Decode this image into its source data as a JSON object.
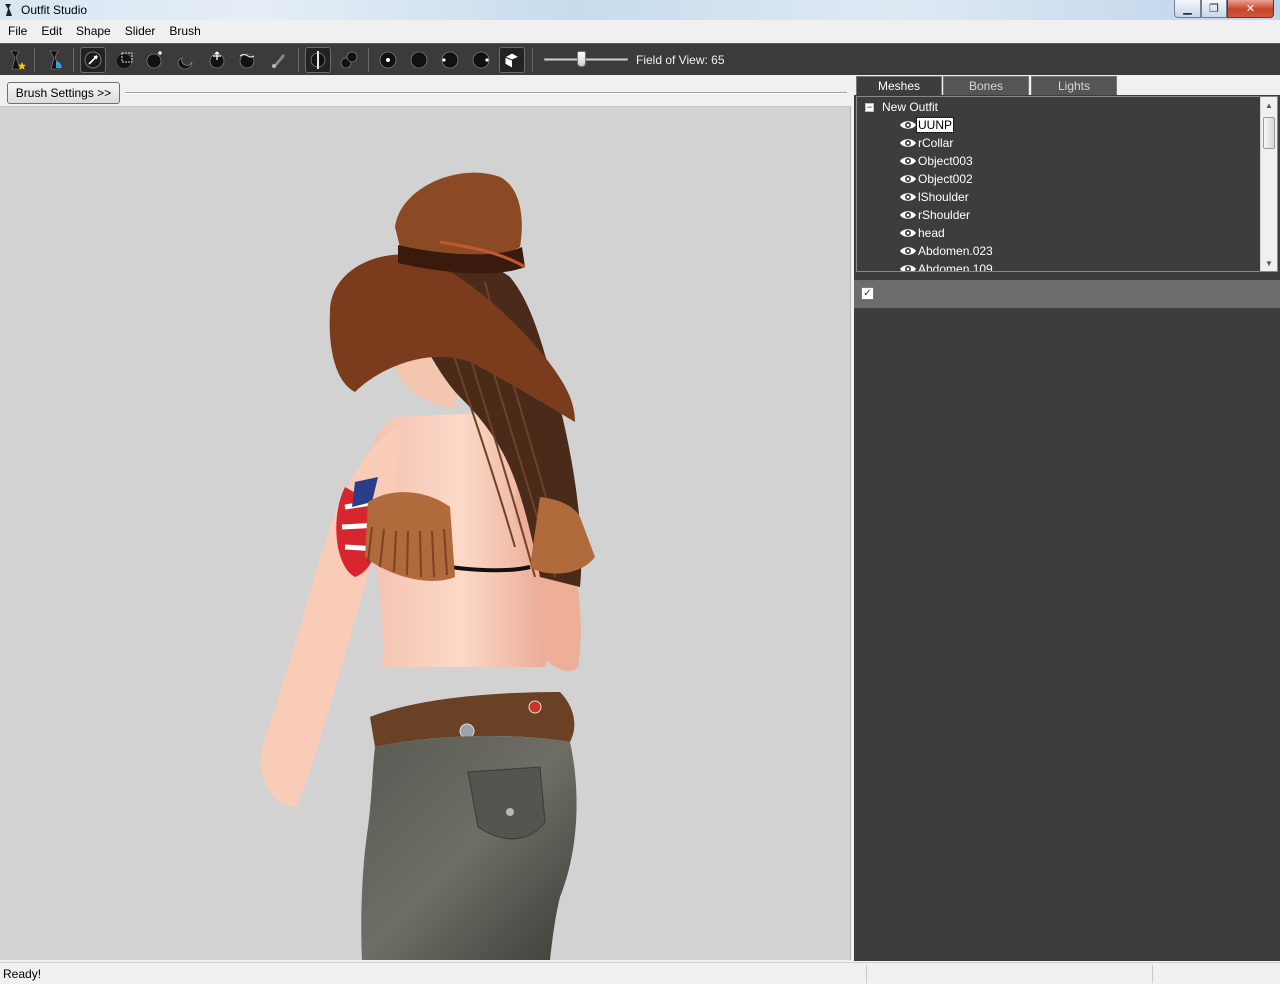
{
  "window": {
    "title": "Outfit Studio"
  },
  "menu": [
    "File",
    "Edit",
    "Shape",
    "Slider",
    "Brush"
  ],
  "toolbar": {
    "buttons": [
      "new-project-icon",
      "load-outfit-icon",
      "select-brush-icon",
      "mask-brush-icon",
      "inflate-brush-icon",
      "deflate-brush-icon",
      "move-brush-icon",
      "smooth-brush-icon",
      "weight-brush-icon",
      "symmetry-x-icon",
      "vertex-color-icon",
      "view-front-icon",
      "view-back-icon",
      "view-left-icon",
      "view-right-icon",
      "perspective-cube-icon"
    ],
    "field_of_view_label": "Field of View: 65",
    "field_of_view_fraction": 0.4
  },
  "left_panel": {
    "brush_settings_label": "Brush Settings >>"
  },
  "right_panel": {
    "tabs": [
      {
        "label": "Meshes",
        "active": true
      },
      {
        "label": "Bones",
        "active": false
      },
      {
        "label": "Lights",
        "active": false
      }
    ],
    "tree": {
      "root": "New Outfit",
      "expander": "−",
      "items": [
        {
          "label": "UUNP",
          "selected": true
        },
        {
          "label": "rCollar",
          "selected": false
        },
        {
          "label": "Object003",
          "selected": false
        },
        {
          "label": "Object002",
          "selected": false
        },
        {
          "label": "lShoulder",
          "selected": false
        },
        {
          "label": "rShoulder",
          "selected": false
        },
        {
          "label": "head",
          "selected": false
        },
        {
          "label": "Abdomen.023",
          "selected": false
        },
        {
          "label": "Abdomen.109",
          "selected": false
        }
      ]
    },
    "slider_header": {
      "checkbox": "✓"
    }
  },
  "status": {
    "text": "Ready!"
  },
  "colors": {
    "toolbar_bg": "#3b3b3b",
    "panel_bg": "#3d3d3d",
    "viewport_bg": "#d2d2d2"
  }
}
